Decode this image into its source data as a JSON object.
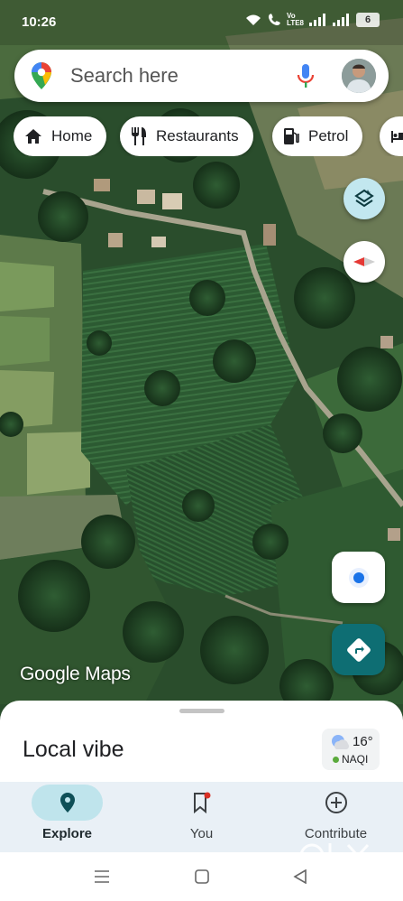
{
  "status_bar": {
    "time": "10:26",
    "network_label_top": "Vo",
    "network_label_bottom": "LTE8",
    "battery": "6"
  },
  "search": {
    "placeholder": "Search here",
    "icons": [
      "google-maps-pin-icon",
      "mic-icon",
      "avatar"
    ]
  },
  "chips": [
    {
      "label": "Home",
      "icon": "home-icon"
    },
    {
      "label": "Restaurants",
      "icon": "restaurant-icon"
    },
    {
      "label": "Petrol",
      "icon": "fuel-icon"
    },
    {
      "label": "",
      "icon": "hotel-icon"
    }
  ],
  "map": {
    "logo_primary": "Google",
    "logo_secondary": "Maps",
    "layers_icon": "layers-icon",
    "compass_icon": "compass-icon",
    "location_icon": "my-location-icon",
    "directions_icon": "directions-icon"
  },
  "sheet": {
    "title": "Local vibe",
    "weather": {
      "temperature": "16°",
      "aqi_label": "NAQI",
      "icon": "partly-cloudy-icon"
    }
  },
  "nav": {
    "items": [
      {
        "label": "Explore",
        "icon": "explore-pin-icon",
        "active": true
      },
      {
        "label": "You",
        "icon": "bookmark-icon",
        "active": false
      },
      {
        "label": "Contribute",
        "icon": "add-circle-icon",
        "active": false
      }
    ]
  },
  "watermark": "OLX",
  "colors": {
    "accent_teal": "#0e6e73",
    "layers_button": "#c2e7ef",
    "nav_background": "#e9f0f6",
    "active_pill": "#bfe4ec",
    "location_blue": "#1a73e8"
  }
}
